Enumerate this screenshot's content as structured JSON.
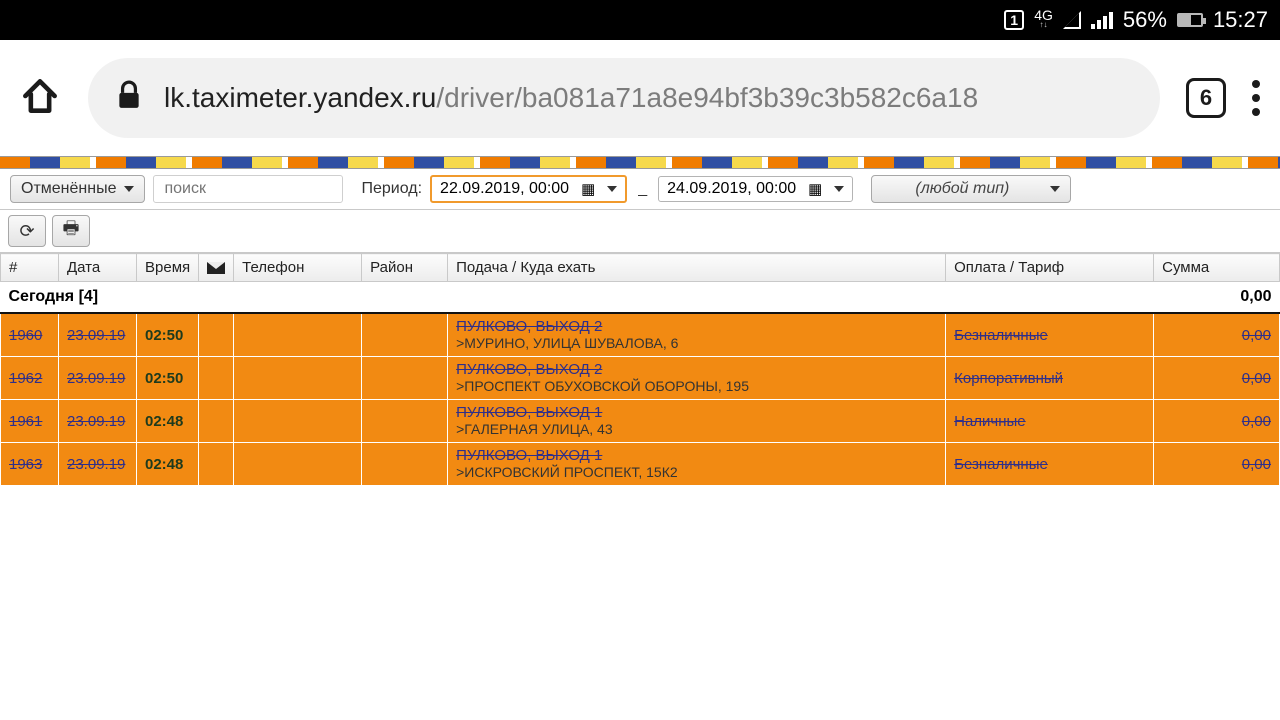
{
  "status": {
    "sim": "1",
    "net": "4G",
    "battery_pct": "56%",
    "time": "15:27"
  },
  "chrome": {
    "url_host": "lk.taximeter.yandex.ru",
    "url_path": "/driver/ba081a71a8e94bf3b39c3b582c6a18",
    "tab_count": "6"
  },
  "filters": {
    "status_label": "Отменённые",
    "search_placeholder": "поиск",
    "period_label": "Период:",
    "date_from": "22.09.2019, 00:00",
    "date_to": "24.09.2019, 00:00",
    "type_label": "(любой тип)",
    "dash": "_"
  },
  "headers": {
    "num": "#",
    "date": "Дата",
    "time": "Время",
    "phone": "Телефон",
    "district": "Район",
    "route": "Подача / Куда ехать",
    "payment": "Оплата / Тариф",
    "sum": "Сумма"
  },
  "group": {
    "label": "Сегодня [4]",
    "total": "0,00"
  },
  "rows": [
    {
      "num": "1960",
      "date": "23.09.19",
      "time": "02:50",
      "pickup": "ПУЛКОВО, ВЫХОД 2",
      "dest": ">МУРИНО, УЛИЦА ШУВАЛОВА, 6",
      "payment": "Безналичные",
      "sum": "0,00"
    },
    {
      "num": "1962",
      "date": "23.09.19",
      "time": "02:50",
      "pickup": "ПУЛКОВО, ВЫХОД 2",
      "dest": ">ПРОСПЕКТ ОБУХОВСКОЙ ОБОРОНЫ, 195",
      "payment": "Корпоративный",
      "sum": "0,00"
    },
    {
      "num": "1961",
      "date": "23.09.19",
      "time": "02:48",
      "pickup": "ПУЛКОВО, ВЫХОД 1",
      "dest": ">ГАЛЕРНАЯ УЛИЦА, 43",
      "payment": "Наличные",
      "sum": "0,00"
    },
    {
      "num": "1963",
      "date": "23.09.19",
      "time": "02:48",
      "pickup": "ПУЛКОВО, ВЫХОД 1",
      "dest": ">ИСКРОВСКИЙ ПРОСПЕКТ, 15К2",
      "payment": "Безналичные",
      "sum": "0,00"
    }
  ]
}
